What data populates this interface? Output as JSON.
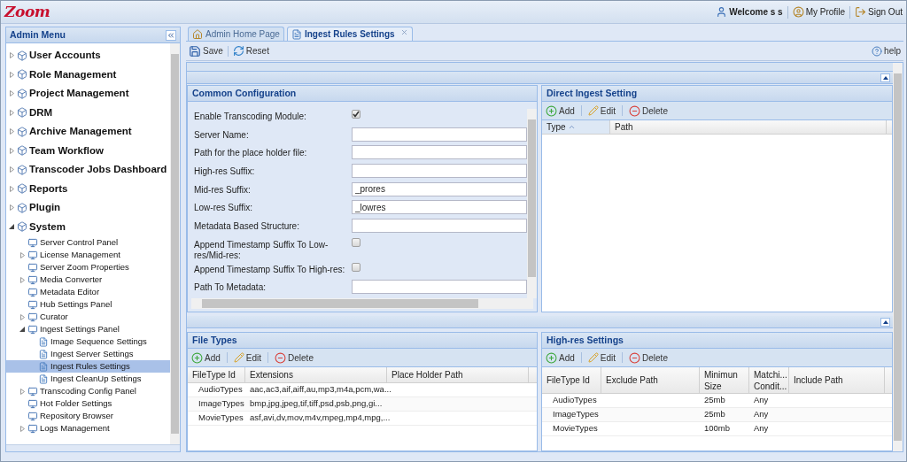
{
  "header": {
    "logo": "Zoom",
    "links": [
      {
        "label": "Welcome s s",
        "kind": "user"
      },
      {
        "label": "My Profile",
        "kind": "profile"
      },
      {
        "label": "Sign Out",
        "kind": "signout"
      }
    ]
  },
  "sidebar": {
    "title": "Admin Menu",
    "items": [
      {
        "label": "User Accounts",
        "expanded": false,
        "selected": false
      },
      {
        "label": "Role Management",
        "expanded": false,
        "selected": false
      },
      {
        "label": "Project Management",
        "expanded": false,
        "selected": false
      },
      {
        "label": "DRM",
        "expanded": false,
        "selected": false
      },
      {
        "label": "Archive Management",
        "expanded": false,
        "selected": false
      },
      {
        "label": "Team Workflow",
        "expanded": false,
        "selected": false
      },
      {
        "label": "Transcoder Jobs Dashboard",
        "expanded": false,
        "selected": false
      },
      {
        "label": "Reports",
        "expanded": false,
        "selected": false
      },
      {
        "label": "Plugin",
        "expanded": false,
        "selected": false
      },
      {
        "label": "System",
        "expanded": true,
        "selected": false,
        "children": [
          {
            "label": "Server Control Panel",
            "selected": false
          },
          {
            "label": "License Management",
            "expanded": false,
            "selected": false
          },
          {
            "label": "Server Zoom Properties",
            "selected": false
          },
          {
            "label": "Media Converter",
            "expanded": false,
            "selected": false
          },
          {
            "label": "Metadata Editor",
            "selected": false
          },
          {
            "label": "Hub Settings Panel",
            "selected": false
          },
          {
            "label": "Curator",
            "expanded": false,
            "selected": false
          },
          {
            "label": "Ingest Settings Panel",
            "expanded": true,
            "selected": false,
            "children": [
              {
                "label": "Image Sequence Settings",
                "selected": false
              },
              {
                "label": "Ingest Server Settings",
                "selected": false
              },
              {
                "label": "Ingest Rules Settings",
                "selected": true
              },
              {
                "label": "Ingest CleanUp Settings",
                "selected": false
              }
            ]
          },
          {
            "label": "Transcoding Config Panel",
            "expanded": false,
            "selected": false
          },
          {
            "label": "Hot Folder Settings",
            "selected": false
          },
          {
            "label": "Repository Browser",
            "selected": false
          },
          {
            "label": "Logs Management",
            "expanded": false,
            "selected": false
          }
        ]
      }
    ]
  },
  "tabs": [
    {
      "label": "Admin Home Page",
      "selected": false,
      "closable": false
    },
    {
      "label": "Ingest Rules Settings",
      "selected": true,
      "closable": true
    }
  ],
  "toolbar": {
    "buttons": [
      {
        "label": "Save",
        "kind": "save"
      },
      {
        "label": "Reset",
        "kind": "reset"
      }
    ],
    "help": "help"
  },
  "common_configuration": {
    "title": "Common Configuration",
    "fields": [
      {
        "label": "Enable Transcoding Module:",
        "kind": "checkbox",
        "checked": true
      },
      {
        "label": "Server Name:",
        "kind": "text"
      },
      {
        "label": "Path for the place holder file:",
        "kind": "text"
      },
      {
        "label": "High-res Suffix:",
        "kind": "text"
      },
      {
        "label": "Mid-res Suffix:",
        "kind": "text",
        "value": "_prores"
      },
      {
        "label": "Low-res Suffix:",
        "kind": "text",
        "value": "_lowres"
      },
      {
        "label": "Metadata Based Structure:",
        "kind": "text"
      },
      {
        "label": "Append Timestamp Suffix To Low-res/Mid-res:",
        "kind": "checkbox",
        "checked": false
      },
      {
        "label": "Append Timestamp Suffix To High-res:",
        "kind": "checkbox",
        "checked": false
      },
      {
        "label": "Path To Metadata:",
        "kind": "text"
      }
    ]
  },
  "direct_ingest": {
    "title": "Direct Ingest Setting",
    "actions": [
      {
        "label": "Add",
        "kind": "add"
      },
      {
        "label": "Edit",
        "kind": "edit"
      },
      {
        "label": "Delete",
        "kind": "delete"
      }
    ],
    "columns": [
      {
        "label": "Type",
        "sorted": true
      },
      {
        "label": "Path",
        "sorted": false
      }
    ]
  },
  "file_types": {
    "title": "File Types",
    "actions": [
      {
        "label": "Add",
        "kind": "add"
      },
      {
        "label": "Edit",
        "kind": "edit"
      },
      {
        "label": "Delete",
        "kind": "delete"
      }
    ],
    "columns": [
      {
        "label": "FileType Id",
        "sorted": false
      },
      {
        "label": "Extensions",
        "sorted": false
      },
      {
        "label": "Place Holder Path",
        "sorted": false
      }
    ],
    "rows": [
      [
        "AudioTypes",
        "aac,ac3,aif,aiff,au,mp3,m4a,pcm,wa...",
        null
      ],
      [
        "ImageTypes",
        "bmp,jpg,jpeg,tif,tiff,psd,psb,png,gi...",
        null
      ],
      [
        "MovieTypes",
        "asf,avi,dv,mov,m4v,mpeg,mp4,mpg,...",
        null
      ]
    ]
  },
  "high_res_settings": {
    "title": "High-res Settings",
    "actions": [
      {
        "label": "Add",
        "kind": "add"
      },
      {
        "label": "Edit",
        "kind": "edit"
      },
      {
        "label": "Delete",
        "kind": "delete"
      }
    ],
    "columns": [
      {
        "label": "FileType Id",
        "sorted": false
      },
      {
        "label": "Exclude Path",
        "sorted": false
      },
      {
        "label": "Minimun Size",
        "sorted": false
      },
      {
        "label": "Matchi... Condit...",
        "sorted": false
      },
      {
        "label": "Include Path",
        "sorted": false
      }
    ],
    "rows": [
      [
        "AudioTypes",
        null,
        "25mb",
        "Any",
        null
      ],
      [
        "ImageTypes",
        null,
        "25mb",
        "Any",
        null
      ],
      [
        "MovieTypes",
        null,
        "100mb",
        "Any",
        null
      ]
    ]
  }
}
